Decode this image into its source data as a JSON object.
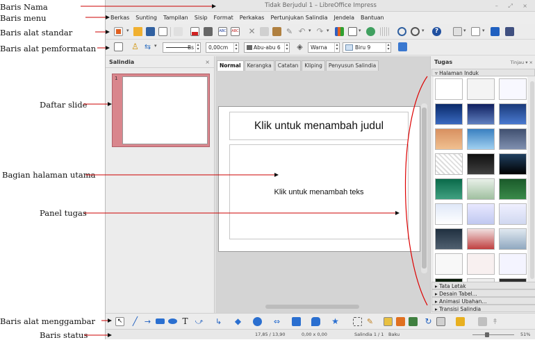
{
  "annotations": [
    {
      "key": "title",
      "label": "Baris Nama"
    },
    {
      "key": "menu",
      "label": "Baris menu"
    },
    {
      "key": "standard",
      "label": "Baris alat standar"
    },
    {
      "key": "format",
      "label": "Baris alat pemformatan"
    },
    {
      "key": "slides",
      "label": "Daftar slide"
    },
    {
      "key": "main",
      "label": "Bagian halaman utama"
    },
    {
      "key": "task",
      "label": "Panel tugas"
    },
    {
      "key": "draw",
      "label": "Baris alat menggambar"
    },
    {
      "key": "status",
      "label": "Baris status"
    }
  ],
  "window": {
    "title": "Tidak Berjudul 1 – LibreOffice Impress",
    "controls": "– ⤢ ×"
  },
  "menu": [
    "Berkas",
    "Sunting",
    "Tampilan",
    "Sisip",
    "Format",
    "Perkakas",
    "Pertunjukan Salindia",
    "Jendela",
    "Bantuan"
  ],
  "format_toolbar": {
    "line_width": "0,00cm",
    "line_style": "Bs",
    "line_color": "Abu-abu 6",
    "area_style": "Warna",
    "area_color": "Biru 9"
  },
  "slide_pane": {
    "title": "Salindia",
    "close": "×",
    "slide_number": "1"
  },
  "editor": {
    "tabs": [
      "Normal",
      "Kerangka",
      "Catatan",
      "Kliping",
      "Penyusun Salindia"
    ],
    "active_tab": "Normal",
    "title_placeholder": "Klik untuk menambah judul",
    "text_placeholder": "Klik untuk menambah teks"
  },
  "task_pane": {
    "title": "Tugas",
    "view_label": "Tinjau",
    "close": "×",
    "open_section": "Halaman Induk",
    "sections": [
      "Tata Letak",
      "Desain Tabel...",
      "Animasi Ubahan...",
      "Transisi Salindia"
    ]
  },
  "status": {
    "position": "17,85 / 13,90",
    "size": "0,00 x 0,00",
    "slide": "Salindia 1 / 1",
    "layout": "Baku",
    "zoom": "51%",
    "zoom_level": 0.35
  },
  "colors": {
    "slide_thumb_bg": "#d9868d",
    "arrow_color": "#cc0000",
    "task_curve": "#dd0000"
  }
}
